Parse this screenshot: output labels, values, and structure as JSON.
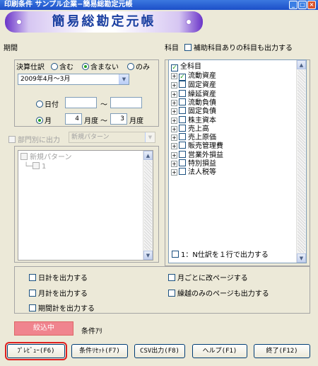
{
  "window": {
    "title": "印刷条件 サンプル企業−簡易総勘定元帳"
  },
  "banner": {
    "title": "簡易総勘定元帳"
  },
  "period": {
    "label": "期間",
    "kessan_label": "決算仕訳",
    "options": [
      "含む",
      "含まない",
      "のみ"
    ],
    "selected_option": "含まない",
    "month_range_value": "2009年4月〜3月",
    "date_label": "日付",
    "tilde": "〜",
    "month_label": "月",
    "month_from": "4",
    "month_to": "3",
    "month_unit": "月度"
  },
  "department": {
    "label": "部門別に出力",
    "pattern_value": "新規パターン",
    "tree_root": "新規パターン",
    "tree_child": "1"
  },
  "subjects": {
    "label": "科目",
    "aux_label": "補助科目ありの科目も出力する",
    "root": "全科目",
    "items": [
      "流動資産",
      "固定資産",
      "繰延資産",
      "流動負債",
      "固定負債",
      "株主資本",
      "売上高",
      "売上原価",
      "販売管理費",
      "営業外損益",
      "特別損益",
      "法人税等"
    ]
  },
  "one_to_n": {
    "label": "1：N仕訳を１行で出力する"
  },
  "options": {
    "daily_total": "日計を出力する",
    "monthly_total": "月計を出力する",
    "period_total": "期間計を出力する",
    "page_per_month": "月ごとに改ページする",
    "carryover_page": "繰越のみのページも出力する"
  },
  "filter": {
    "button": "絞込中",
    "label": "条件ｱﾘ"
  },
  "footer": {
    "preview": "ﾌﾟﾚﾋﾞｭｰ(F6)",
    "reset": "条件ﾘｾｯﾄ(F7)",
    "csv": "CSV出力(F8)",
    "help": "ヘルプ(F1)",
    "exit": "終了(F12)"
  }
}
